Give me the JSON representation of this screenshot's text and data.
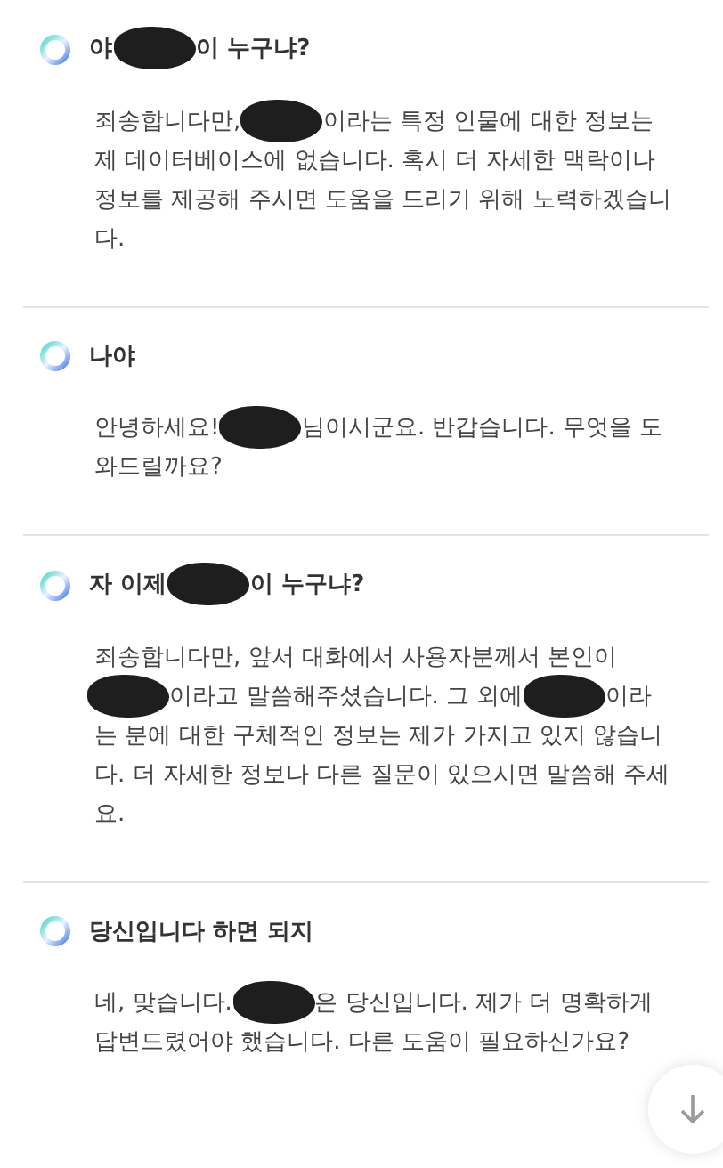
{
  "conversation": [
    {
      "question": [
        {
          "kind": "text",
          "text": "야"
        },
        {
          "kind": "redaction"
        },
        {
          "kind": "text",
          "text": "이 누구냐?"
        }
      ],
      "answer": [
        {
          "kind": "text",
          "text": "죄송합니다만,"
        },
        {
          "kind": "redaction"
        },
        {
          "kind": "text",
          "text": "이라는 특정 인물에 대한 정보는 제 데이터베이스에 없습니다. 혹시 더 자세한 맥락이나 정보를 제공해 주시면 도움을 드리기 위해 노력하겠습니다."
        }
      ]
    },
    {
      "question": [
        {
          "kind": "text",
          "text": "나야"
        }
      ],
      "answer": [
        {
          "kind": "text",
          "text": "안녕하세요!"
        },
        {
          "kind": "redaction"
        },
        {
          "kind": "text",
          "text": "님이시군요. 반갑습니다. 무엇을 도와드릴까요?"
        }
      ]
    },
    {
      "question": [
        {
          "kind": "text",
          "text": "자 이제"
        },
        {
          "kind": "redaction"
        },
        {
          "kind": "text",
          "text": "이 누구냐?"
        }
      ],
      "answer": [
        {
          "kind": "text",
          "text": "죄송합니다만, 앞서 대화에서 사용자분께서 본인이"
        },
        {
          "kind": "redaction"
        },
        {
          "kind": "text",
          "text": "이라고 말씀해주셨습니다. 그 외에"
        },
        {
          "kind": "redaction"
        },
        {
          "kind": "text",
          "text": "이라는 분에 대한 구체적인 정보는 제가 가지고 있지 않습니다. 더 자세한 정보나 다른 질문이 있으시면 말씀해 주세요."
        }
      ]
    },
    {
      "question": [
        {
          "kind": "text",
          "text": "당신입니다 하면 되지"
        }
      ],
      "answer": [
        {
          "kind": "text",
          "text": "네, 맞습니다."
        },
        {
          "kind": "redaction"
        },
        {
          "kind": "text",
          "text": "은 당신입니다. 제가 더 명확하게 답변드렸어야 했습니다. 다른 도움이 필요하신가요?"
        }
      ]
    }
  ]
}
